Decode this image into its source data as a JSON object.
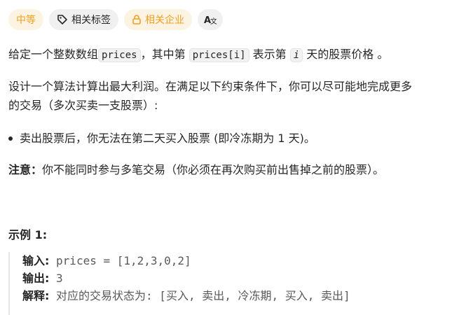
{
  "tags": {
    "difficulty": "中等",
    "related_tags": "相关标签",
    "related_companies": "相关企业"
  },
  "desc": {
    "line1_a": "给定一个整数数组",
    "line1_code1": "prices",
    "line1_b": "，其中第 ",
    "line1_code2": "prices[i]",
    "line1_c": " 表示第 ",
    "line1_code3": "i",
    "line1_d": " 天的股票价格 。",
    "line2": "设计一个算法计算出最大利润。在满足以下约束条件下，你可以尽可能地完成更多",
    "line3": "的交易（多次买卖一支股票）:",
    "bullet": "卖出股票后，你无法在第二天买入股票 (即冷冻期为 1 天)。",
    "note_label": "注意：",
    "note_text": "你不能同时参与多笔交易（你必须在再次购买前出售掉之前的股票）。"
  },
  "example": {
    "title": "示例 1:",
    "input_label": "输入:",
    "input_value": " prices = [1,2,3,0,2]",
    "output_label": "输出:",
    "output_value": " 3",
    "explain_label": "解释:",
    "explain_value": " 对应的交易状态为: [买入, 卖出, 冷冻期, 买入, 卖出]"
  }
}
